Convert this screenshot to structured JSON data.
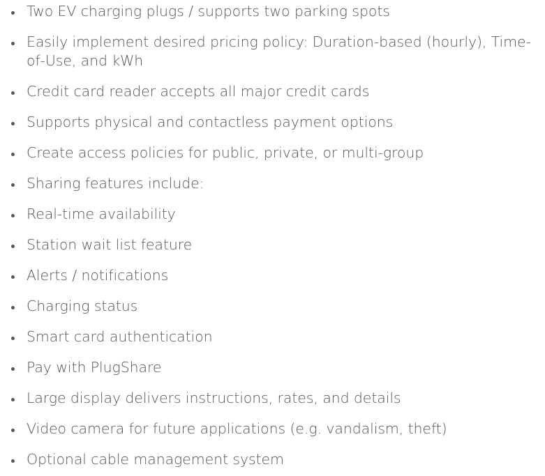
{
  "features": [
    "Two EV charging plugs / supports two parking spots",
    "Easily implement desired pricing policy: Duration-based (hourly), Time-of-Use, and kWh",
    "Credit card reader accepts all major credit cards",
    "Supports physical and contactless payment options",
    "Create access policies for public, private, or multi-group",
    "Sharing features include:",
    "Real-time availability",
    "Station wait list feature",
    "Alerts / notifications",
    "Charging status",
    "Smart card authentication",
    "Pay with PlugShare",
    "Large display delivers instructions, rates, and details",
    "Video camera for future applications (e.g. vandalism, theft)",
    "Optional cable management system"
  ]
}
